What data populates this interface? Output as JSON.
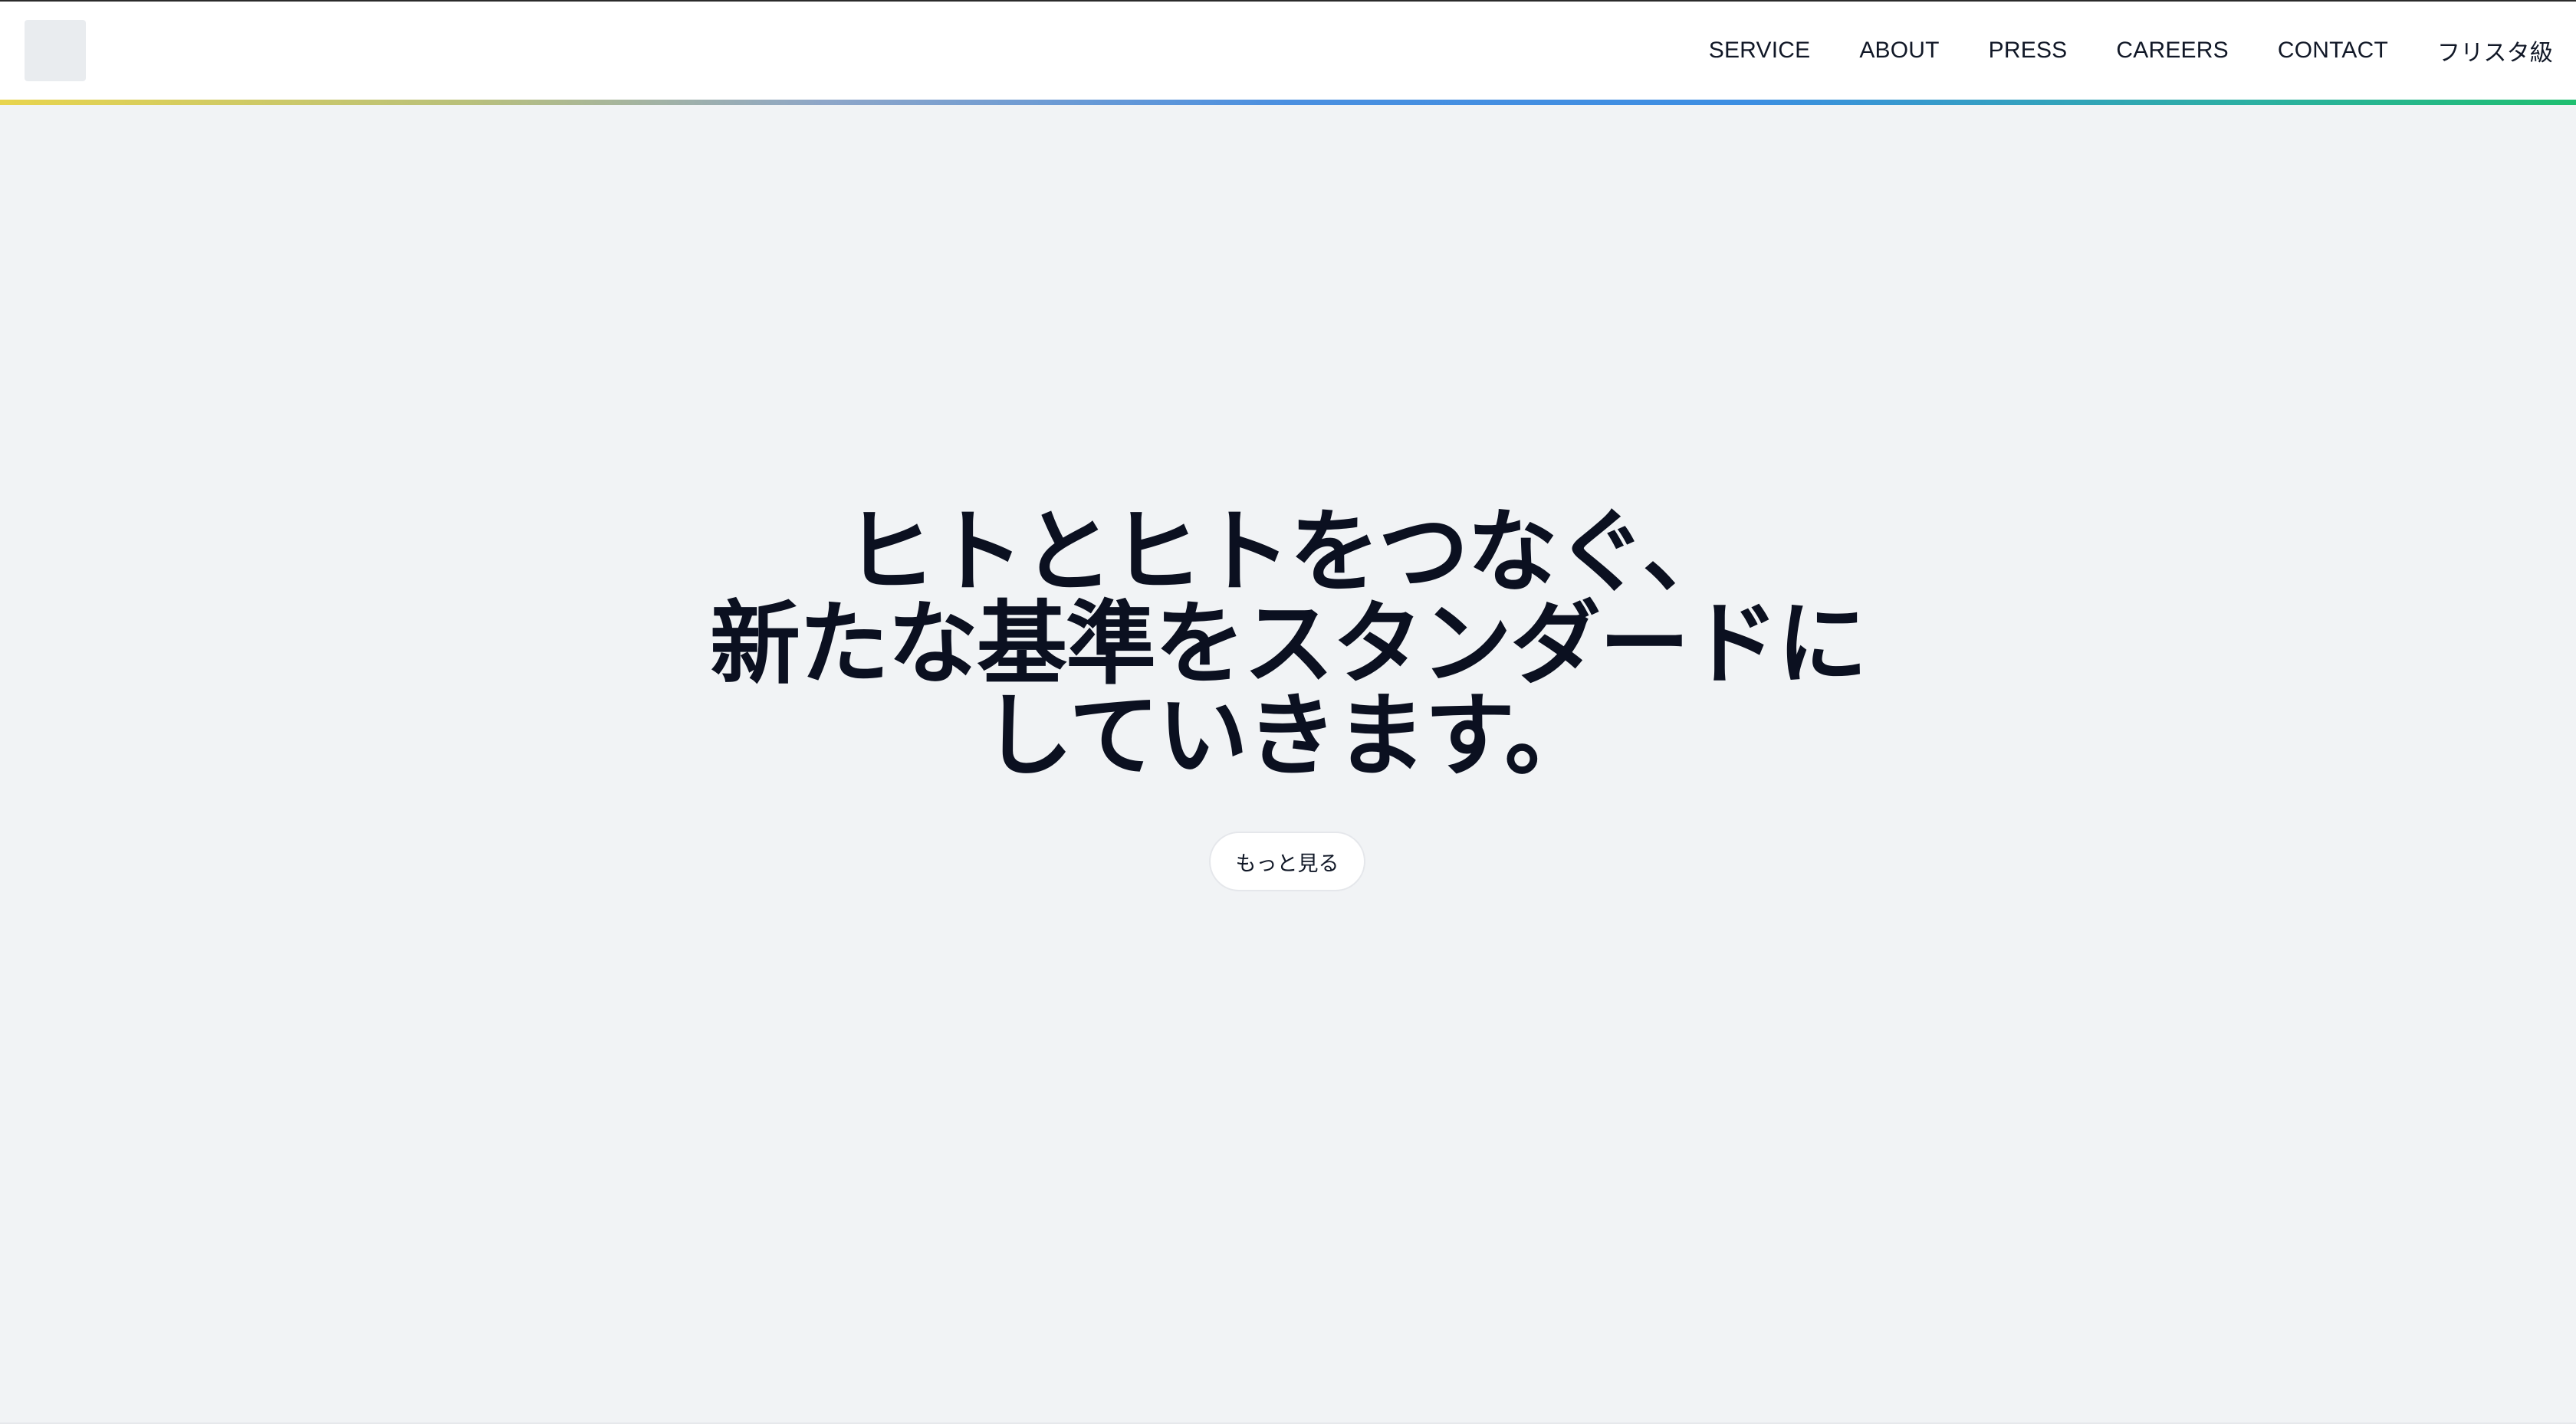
{
  "header": {
    "nav": [
      {
        "label": "SERVICE"
      },
      {
        "label": "ABOUT"
      },
      {
        "label": "PRESS"
      },
      {
        "label": "CAREERS"
      },
      {
        "label": "CONTACT"
      },
      {
        "label": "フリスタ級"
      }
    ]
  },
  "hero": {
    "title_lines": [
      "ヒトとヒトをつなぐ、",
      "新たな基準をスタンダードに",
      "していきます。"
    ],
    "more_button_label": "もっと見る"
  },
  "colors": {
    "background": "#f1f3f5",
    "header_background": "#ffffff",
    "title_color": "#0b1020",
    "gradient": [
      "#e8d44d",
      "#4a8fe0",
      "#1fbf70"
    ]
  }
}
